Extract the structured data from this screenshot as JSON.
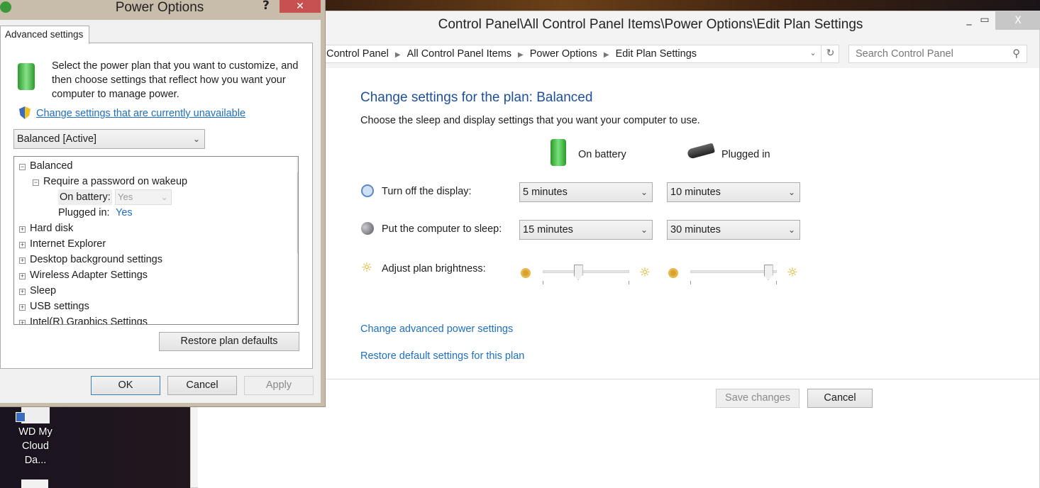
{
  "control_panel": {
    "title": "Control Panel\\All Control Panel Items\\Power Options\\Edit Plan Settings",
    "breadcrumb": [
      "Control Panel",
      "All Control Panel Items",
      "Power Options",
      "Edit Plan Settings"
    ],
    "search_placeholder": "Search Control Panel",
    "heading": "Change settings for the plan: Balanced",
    "subheading": "Choose the sleep and display settings that you want your computer to use.",
    "col_battery": "On battery",
    "col_plugged": "Plugged in",
    "display_label": "Turn off the display:",
    "display_battery": "5 minutes",
    "display_plugged": "10 minutes",
    "sleep_label": "Put the computer to sleep:",
    "sleep_battery": "15 minutes",
    "sleep_plugged": "30 minutes",
    "brightness_label": "Adjust plan brightness:",
    "brightness_battery_percent": 40,
    "brightness_plugged_percent": 95,
    "advanced_link": "Change advanced power settings",
    "restore_link": "Restore default settings for this plan",
    "save_button": "Save changes",
    "cancel_button": "Cancel",
    "close_glyph": "X"
  },
  "dialog": {
    "title": "Power Options",
    "help": "?",
    "tab": "Advanced settings",
    "intro": "Select the power plan that you want to customize, and then choose settings that reflect how you want your computer to manage power.",
    "uac_link": "Change settings that are currently unavailable",
    "plan_select": "Balanced [Active]",
    "tree": {
      "root": "Balanced",
      "child": "Require a password on wakeup",
      "on_battery_label": "On battery:",
      "on_battery_value": "Yes",
      "plugged_label": "Plugged in:",
      "plugged_value": "Yes",
      "items": [
        "Hard disk",
        "Internet Explorer",
        "Desktop background settings",
        "Wireless Adapter Settings",
        "Sleep",
        "USB settings",
        "Intel(R) Graphics Settings"
      ]
    },
    "restore_button": "Restore plan defaults",
    "ok": "OK",
    "cancel": "Cancel",
    "apply": "Apply"
  },
  "desktop": {
    "icon_label": "WD My Cloud Da..."
  }
}
